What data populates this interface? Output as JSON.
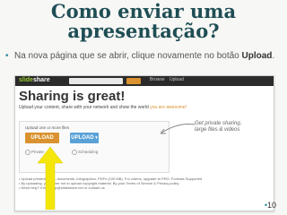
{
  "slide": {
    "title_line1": "Como enviar uma",
    "title_line2": "apresentação?",
    "bullet_text": "Na nova página que se abrir, clique novamente no botão ",
    "bullet_bold": "Upload",
    "bullet_end": ".",
    "page_number": "10"
  },
  "screenshot": {
    "logo_part1": "slide",
    "logo_part2": "share",
    "nav_items": [
      "Browse",
      "Upload"
    ],
    "heading": "Sharing is great!",
    "subheading": "Upload your content, share with your network and show the world ",
    "subheading_highlight": "you are awesome!",
    "panel_label": "Upload one or more files",
    "upload_button": "UPLOAD",
    "upload_pro_button": "UPLOAD",
    "privacy_label": "Private",
    "schedule_label": "Scheduling",
    "annotation_line1": "Get private sharing,",
    "annotation_line2": "large files & videos",
    "notes": [
      "Upload presentations, documents, infographics, PDFs (100 MB). For videos, upgrade to PRO. Formats Supported",
      "By uploading, you agree not to upload copyright material. By your Terms of Service & Privacy policy",
      "Need help? Email help@slideshare.net or contact us"
    ]
  },
  "colors": {
    "title": "#1f4e55",
    "accent": "#2c8c9c",
    "upload_orange": "#d9922f",
    "upload_blue": "#5aa1d8",
    "arrow_yellow": "#f5e60a"
  }
}
